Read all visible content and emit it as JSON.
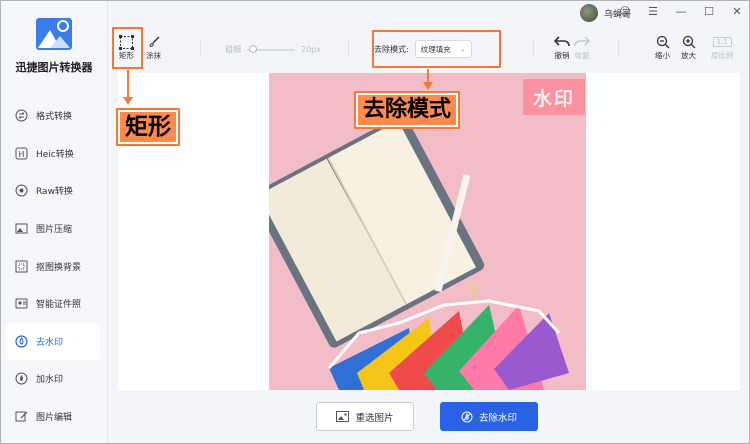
{
  "app": {
    "title": "迅捷图片转换器",
    "user_name": "乌蝇哥",
    "window_buttons": [
      "☺",
      "☰",
      "—",
      "☐",
      "✕"
    ]
  },
  "sidebar": {
    "items": [
      {
        "label": "格式转换",
        "icon": "swap-icon"
      },
      {
        "label": "Heic转换",
        "icon": "heic-icon"
      },
      {
        "label": "Raw转换",
        "icon": "raw-icon"
      },
      {
        "label": "图片压缩",
        "icon": "compress-icon"
      },
      {
        "label": "抠图换背景",
        "icon": "cutout-icon"
      },
      {
        "label": "智能证件照",
        "icon": "id-photo-icon"
      },
      {
        "label": "去水印",
        "icon": "remove-watermark-icon",
        "active": true
      },
      {
        "label": "加水印",
        "icon": "add-watermark-icon"
      },
      {
        "label": "图片编辑",
        "icon": "edit-icon"
      }
    ]
  },
  "toolbar": {
    "rect_label": "矩形",
    "brush_label": "涂抹",
    "thickness_label": "粗细",
    "thickness_value": "20px",
    "mode_label": "去除模式:",
    "mode_value": "纹理填充",
    "undo_label": "撤销",
    "redo_label": "恢复",
    "zoom_out_label": "缩小",
    "zoom_in_label": "放大",
    "original_ratio_label": "原比例",
    "original_ratio_badge": "1:1"
  },
  "annotations": {
    "rect_callout": "矩形",
    "mode_callout": "去除模式",
    "watermark_text": "水印"
  },
  "actions": {
    "reselect_label": "重选图片",
    "remove_label": "去除水印"
  },
  "colors": {
    "accent": "#2a62e6",
    "callout": "#ef7a3e",
    "photo_bg": "#f3bdc8"
  }
}
